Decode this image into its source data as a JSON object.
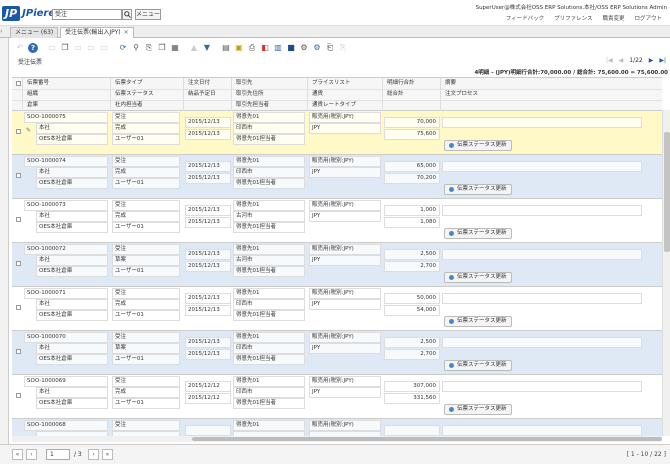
{
  "header": {
    "logo_mark": "JP",
    "logo_text": "JPiere",
    "search_value": "受注",
    "menu_label": "メニュー",
    "user_info": "SuperUser@株式会社OSS ERP Solutions.本社/OSS ERP Solutions Admin",
    "links": [
      "フィードバック",
      "プリファレンス",
      "職責変更",
      "ログアウト"
    ]
  },
  "tabs": [
    {
      "label": "メニュー (63)"
    },
    {
      "label": "受注伝票(輸出入JPY)",
      "close": "✕"
    }
  ],
  "window_title": "受注伝票",
  "record_nav": {
    "position": "1/22"
  },
  "summary": "4明細 - (JPY)明細行合計:70,000.00 / 総合計: 75,600.00 = 75,600.00",
  "columns": {
    "r1": [
      "伝票番号",
      "伝票タイプ",
      "注文日付",
      "取引先",
      "プライスリスト",
      "明細行合計",
      "摘要"
    ],
    "r2": [
      "組織",
      "伝票ステータス",
      "納品予定日",
      "取引先住所",
      "通貨",
      "総合計",
      "注文プロセス"
    ],
    "r3": [
      "倉庫",
      "社内担当者",
      "",
      "取引先担当者",
      "通貨レートタイプ",
      "",
      ""
    ]
  },
  "status_button_label": "伝票ステータス更新",
  "rows": [
    {
      "doc": "SOO-1000075",
      "org": "本社",
      "wh": "OES本社倉庫",
      "type": "受注",
      "status": "完成",
      "rep": "ユーザー01",
      "order_date": "2015/12/13",
      "promise_date": "2015/12/13",
      "bp": "得意先01",
      "loc": "印西市",
      "contact": "得意先01担当者",
      "pl": "販売用(税別:JPY)",
      "cur": "JPY",
      "lines": "70,000",
      "total": "75,600",
      "style": "yellow",
      "selected": true
    },
    {
      "doc": "SOO-1000074",
      "org": "本社",
      "wh": "OES本社倉庫",
      "type": "受注",
      "status": "完成",
      "rep": "ユーザー01",
      "order_date": "2015/12/13",
      "promise_date": "2015/12/13",
      "bp": "得意先01",
      "loc": "印西市",
      "contact": "得意先01担当者",
      "pl": "販売用(税別:JPY)",
      "cur": "JPY",
      "lines": "65,000",
      "total": "70,200",
      "style": "blue"
    },
    {
      "doc": "SOO-1000073",
      "org": "本社",
      "wh": "OES本社倉庫",
      "type": "受注",
      "status": "完成",
      "rep": "ユーザー01",
      "order_date": "2015/12/13",
      "promise_date": "2015/12/13",
      "bp": "得意先01",
      "loc": "古河市",
      "contact": "得意先01担当者",
      "pl": "販売用(税別:JPY)",
      "cur": "JPY",
      "lines": "1,000",
      "total": "1,080",
      "style": "white"
    },
    {
      "doc": "SOO-1000072",
      "org": "本社",
      "wh": "OES本社倉庫",
      "type": "受注",
      "status": "草案",
      "rep": "ユーザー01",
      "order_date": "2015/12/13",
      "promise_date": "2015/12/13",
      "bp": "得意先01",
      "loc": "古河市",
      "contact": "得意先01担当者",
      "pl": "販売用(税別:JPY)",
      "cur": "JPY",
      "lines": "2,500",
      "total": "2,700",
      "style": "blue"
    },
    {
      "doc": "SOO-1000071",
      "org": "本社",
      "wh": "OES本社倉庫",
      "type": "受注",
      "status": "完成",
      "rep": "ユーザー01",
      "order_date": "2015/12/13",
      "promise_date": "2015/12/13",
      "bp": "得意先01",
      "loc": "印西市",
      "contact": "得意先01担当者",
      "pl": "販売用(税別:JPY)",
      "cur": "JPY",
      "lines": "50,000",
      "total": "54,000",
      "style": "white"
    },
    {
      "doc": "SOO-1000070",
      "org": "本社",
      "wh": "OES本社倉庫",
      "type": "受注",
      "status": "草案",
      "rep": "ユーザー01",
      "order_date": "2015/12/13",
      "promise_date": "2015/12/13",
      "bp": "得意先01",
      "loc": "印西市",
      "contact": "得意先01担当者",
      "pl": "販売用(税別:JPY)",
      "cur": "JPY",
      "lines": "2,500",
      "total": "2,700",
      "style": "blue"
    },
    {
      "doc": "SOO-1000069",
      "org": "本社",
      "wh": "OES本社倉庫",
      "type": "受注",
      "status": "完成",
      "rep": "ユーザー01",
      "order_date": "2015/12/12",
      "promise_date": "2015/12/12",
      "bp": "得意先01",
      "loc": "印西市",
      "contact": "得意先01担当者",
      "pl": "販売用(税別:JPY)",
      "cur": "JPY",
      "lines": "307,000",
      "total": "331,560",
      "style": "white"
    },
    {
      "doc": "SOO-1000068",
      "org": "",
      "wh": "",
      "type": "受注",
      "status": "",
      "rep": "",
      "order_date": "",
      "promise_date": "",
      "bp": "得意先01",
      "loc": "",
      "contact": "",
      "pl": "販売用(税別:JPY)",
      "cur": "",
      "lines": "",
      "total": "",
      "style": "blue"
    }
  ],
  "footer": {
    "page_value": "1",
    "page_total": "/ 3",
    "range": "[ 1 - 10 / 22 ]"
  }
}
